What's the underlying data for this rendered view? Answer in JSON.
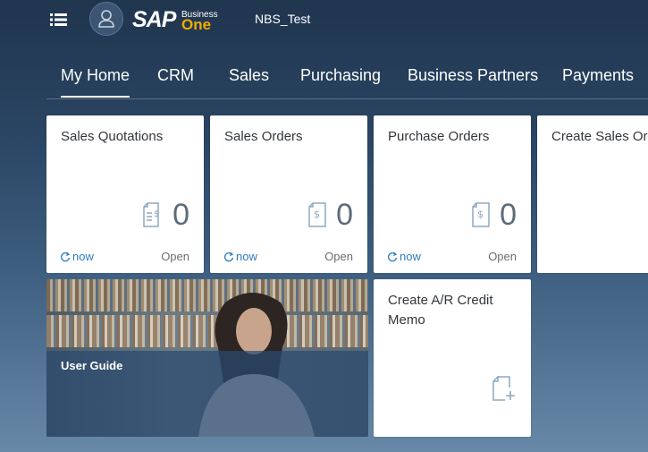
{
  "shell": {
    "system_name": "NBS_Test",
    "logo": {
      "sap": "SAP",
      "business": "Business",
      "one": "One"
    }
  },
  "tabs": [
    {
      "label": "My Home",
      "active": true
    },
    {
      "label": "CRM"
    },
    {
      "label": "Sales"
    },
    {
      "label": "Purchasing"
    },
    {
      "label": "Business Partners"
    },
    {
      "label": "Payments"
    }
  ],
  "tiles": [
    {
      "title": "Sales Quotations",
      "value": "0",
      "refresh": "now",
      "status": "Open",
      "icon": "document-dollar-icon"
    },
    {
      "title": "Sales Orders",
      "value": "0",
      "refresh": "now",
      "status": "Open",
      "icon": "document-dollar-icon"
    },
    {
      "title": "Purchase Orders",
      "value": "0",
      "refresh": "now",
      "status": "Open",
      "icon": "document-dollar-icon"
    },
    {
      "title": "Create Sales Or"
    }
  ],
  "user_guide": {
    "title": "User Guide"
  },
  "credit_memo": {
    "title": "Create A/R Credit Memo",
    "icon": "new-document-icon"
  },
  "colors": {
    "accent": "#2b7cc1",
    "logo_orange": "#f0ab00",
    "tile_bg": "#ffffff",
    "text": "#32363a"
  }
}
